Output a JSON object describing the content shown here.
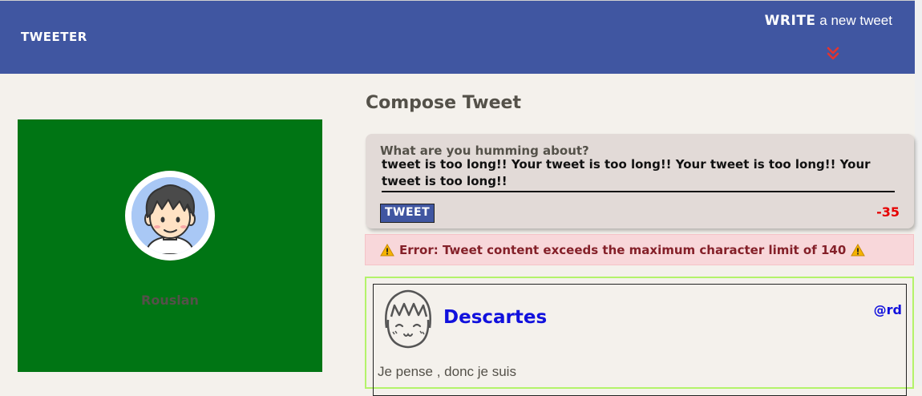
{
  "nav": {
    "brand": "TWEETER",
    "write_strong": "WRITE",
    "write_rest": " a new tweet",
    "icon": "double-chevron-down-icon",
    "bg_color": "#4056a1",
    "accent_color": "#e3342f"
  },
  "profile": {
    "name": "Rouslan",
    "bg_color": "#007514"
  },
  "compose": {
    "title": "Compose Tweet",
    "prompt": "What are you humming about?",
    "text": "tweet is too long!! Your tweet is too long!! Your tweet is too long!! Your tweet is too long!!",
    "button_label": "TWEET",
    "counter": "-35",
    "counter_color": "#e60000"
  },
  "error": {
    "message": "Error: Tweet content exceeds the maximum character limit of 140",
    "icon": "warning-icon"
  },
  "tweets": [
    {
      "name": "Descartes",
      "handle": "@rd",
      "content": "Je pense , donc je suis"
    }
  ]
}
